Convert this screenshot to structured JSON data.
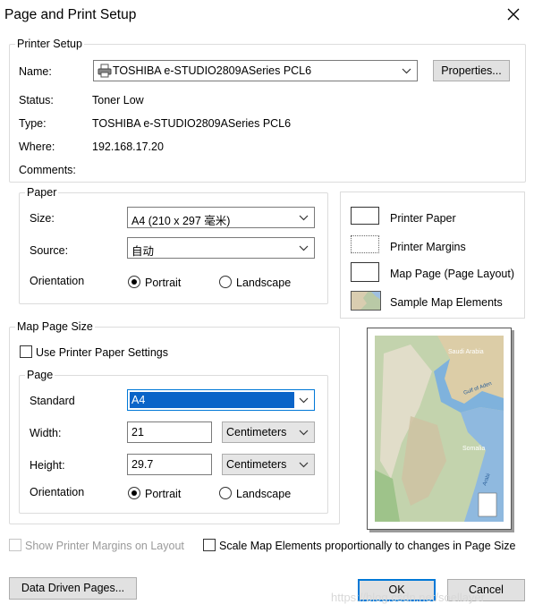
{
  "window": {
    "title": "Page and Print Setup",
    "close_icon": "close-icon"
  },
  "printer_setup": {
    "legend": "Printer Setup",
    "name_label": "Name:",
    "name_value": "TOSHIBA e-STUDIO2809ASeries PCL6",
    "properties_label": "Properties...",
    "status_label": "Status:",
    "status_value": "Toner Low",
    "type_label": "Type:",
    "type_value": "TOSHIBA e-STUDIO2809ASeries PCL6",
    "where_label": "Where:",
    "where_value": "192.168.17.20",
    "comments_label": "Comments:",
    "comments_value": ""
  },
  "paper": {
    "legend": "Paper",
    "size_label": "Size:",
    "size_value": "A4 (210 x 297 毫米)",
    "source_label": "Source:",
    "source_value": "自动",
    "orientation_label": "Orientation",
    "portrait_label": "Portrait",
    "landscape_label": "Landscape",
    "orientation_selected": "Portrait"
  },
  "legend_items": [
    {
      "label": "Printer Paper"
    },
    {
      "label": "Printer Margins"
    },
    {
      "label": "Map Page (Page Layout)"
    },
    {
      "label": "Sample Map Elements"
    }
  ],
  "map_page_size": {
    "legend": "Map Page Size",
    "use_printer_label": "Use Printer Paper Settings",
    "use_printer_checked": false,
    "page_legend": "Page",
    "standard_label": "Standard",
    "standard_value": "A4",
    "width_label": "Width:",
    "width_value": "21",
    "width_unit": "Centimeters",
    "height_label": "Height:",
    "height_value": "29.7",
    "height_unit": "Centimeters",
    "orientation_label": "Orientation",
    "portrait_label": "Portrait",
    "landscape_label": "Landscape",
    "orientation_selected": "Portrait"
  },
  "preview": {
    "labels": [
      "Saudi Arabia",
      "Gulf of Aden",
      "Somalia",
      "Arabi"
    ]
  },
  "options": {
    "show_margins_label": "Show Printer Margins on Layout",
    "show_margins_checked": false,
    "show_margins_enabled": false,
    "scale_elements_label": "Scale Map Elements proportionally to changes in Page Size",
    "scale_elements_checked": false
  },
  "footer": {
    "data_driven_label": "Data Driven Pages...",
    "ok_label": "OK",
    "cancel_label": "Cancel",
    "watermark": "https://blog.csdn.net/soellayer"
  },
  "colors": {
    "accent": "#0078d7",
    "selection": "#0a64c8"
  }
}
